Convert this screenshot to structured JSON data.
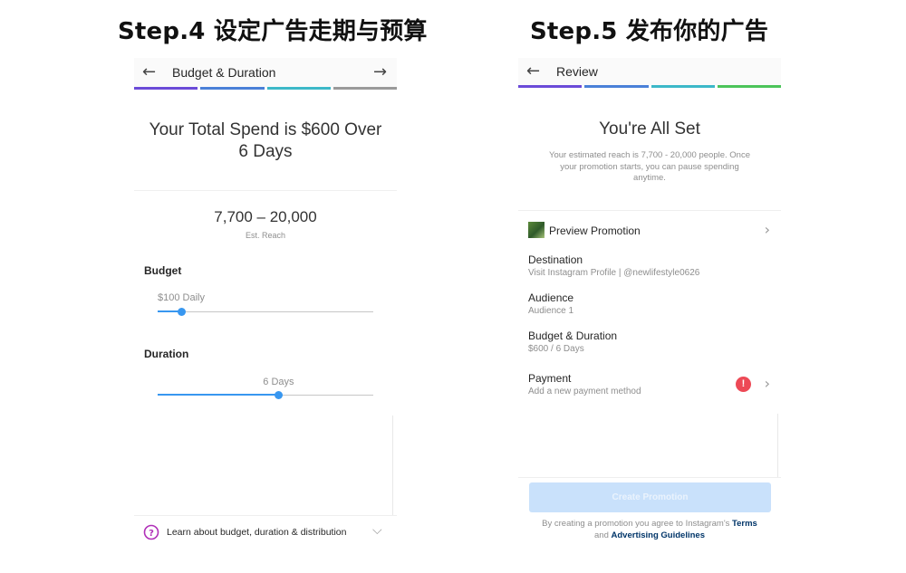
{
  "headings": {
    "step4": "Step.4 设定广告走期与预算",
    "step5": "Step.5 发布你的广告"
  },
  "colors": {
    "accent": "#3897f0",
    "progress": [
      "#6b4bd8",
      "#4a80d8",
      "#3cb8c8",
      "#4cc45a"
    ],
    "error": "#ed4956"
  },
  "budget_screen": {
    "back_icon": "arrow-left-icon",
    "next_icon": "arrow-right-icon",
    "title": "Budget & Duration",
    "total_line1": "Your Total Spend is $600 Over",
    "total_line2": "6 Days",
    "reach_value": "7,700 – 20,000",
    "reach_label": "Est. Reach",
    "budget_heading": "Budget",
    "budget_value": "$100 Daily",
    "budget_level": 0.11,
    "duration_heading": "Duration",
    "duration_value": "6 Days",
    "duration_level": 0.56,
    "learn_icon": "question-circle-icon",
    "learn_text": "Learn about budget, duration & distribution",
    "expand_icon": "chevron-down-icon"
  },
  "review_screen": {
    "back_icon": "arrow-left-icon",
    "title": "Review",
    "heading": "You're All Set",
    "reach_text_line1": "Your estimated reach is 7,700 - 20,000 people. Once",
    "reach_text_line2": "your promotion starts, you can pause spending",
    "reach_text_line3": "anytime.",
    "preview_label": "Preview Promotion",
    "rows": [
      {
        "title": "Destination",
        "sub": "Visit Instagram Profile | @newlifestyle0626"
      },
      {
        "title": "Audience",
        "sub": "Audience 1"
      },
      {
        "title": "Budget & Duration",
        "sub": "$600 / 6 Days"
      },
      {
        "title": "Payment",
        "sub": "Add a new payment method"
      }
    ],
    "payment_alert_icon": "alert-icon",
    "payment_alert_text": "!",
    "create_button": "Create Promotion",
    "terms_prefix": "By creating a promotion you agree to Instagram's",
    "terms_link": "Terms",
    "terms_and": "and",
    "guidelines_link": "Advertising Guidelines"
  }
}
